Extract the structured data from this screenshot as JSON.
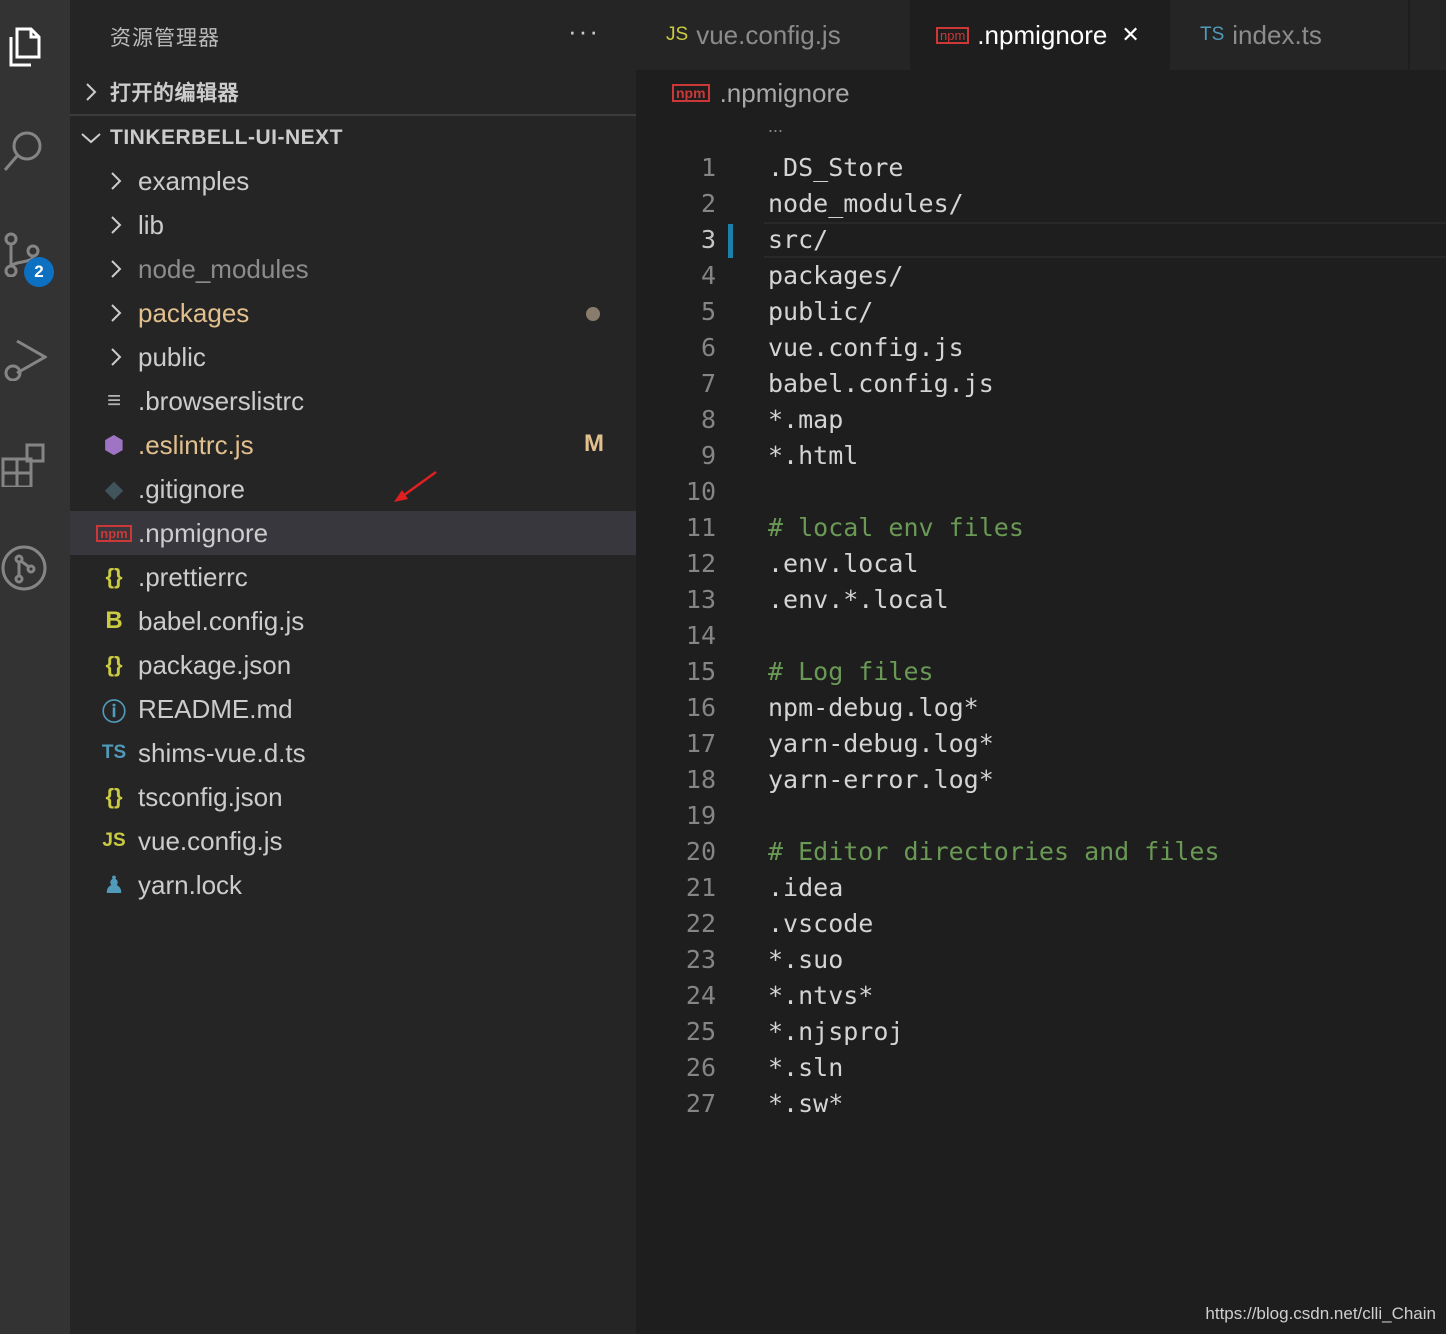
{
  "activity": {
    "badge_count": "2",
    "icons": [
      "files-icon",
      "search-icon",
      "source-control-icon",
      "run-debug-icon",
      "extensions-icon",
      "git-graph-icon"
    ]
  },
  "sidebar": {
    "title": "资源管理器",
    "more": "···",
    "open_editors": "打开的编辑器",
    "project": "TINKERBELL-UI-NEXT",
    "items": [
      {
        "name": "examples",
        "type": "folder",
        "color": "#cccccc"
      },
      {
        "name": "lib",
        "type": "folder",
        "color": "#cccccc"
      },
      {
        "name": "node_modules",
        "type": "folder",
        "color": "#8c8c8c"
      },
      {
        "name": "packages",
        "type": "folder",
        "color": "#e2c08d"
      },
      {
        "name": "public",
        "type": "folder",
        "color": "#cccccc"
      },
      {
        "name": ".browserslistrc",
        "type": "file",
        "icon": "≡",
        "icon_color": "#b5b5b5",
        "color": "#cccccc"
      },
      {
        "name": ".eslintrc.js",
        "type": "file",
        "icon": "⬢",
        "icon_color": "#a074c4",
        "color": "#e2c08d",
        "deco": "M"
      },
      {
        "name": ".gitignore",
        "type": "file",
        "icon": "◆",
        "icon_color": "#41535b",
        "color": "#cccccc"
      },
      {
        "name": ".npmignore",
        "type": "file",
        "icon": "npm",
        "icon_color": "#cb3837",
        "color": "#cccccc"
      },
      {
        "name": ".prettierrc",
        "type": "file",
        "icon": "{}",
        "icon_color": "#cbcb41",
        "color": "#cccccc"
      },
      {
        "name": "babel.config.js",
        "type": "file",
        "icon": "B",
        "icon_color": "#cbcb41",
        "color": "#cccccc"
      },
      {
        "name": "package.json",
        "type": "file",
        "icon": "{}",
        "icon_color": "#cbcb41",
        "color": "#cccccc"
      },
      {
        "name": "README.md",
        "type": "file",
        "icon": "ⓘ",
        "icon_color": "#519aba",
        "color": "#cccccc"
      },
      {
        "name": "shims-vue.d.ts",
        "type": "file",
        "icon": "TS",
        "icon_color": "#519aba",
        "color": "#cccccc"
      },
      {
        "name": "tsconfig.json",
        "type": "file",
        "icon": "{}",
        "icon_color": "#cbcb41",
        "color": "#cccccc"
      },
      {
        "name": "vue.config.js",
        "type": "file",
        "icon": "JS",
        "icon_color": "#cbcb41",
        "color": "#cccccc"
      },
      {
        "name": "yarn.lock",
        "type": "file",
        "icon": "♟",
        "icon_color": "#519aba",
        "color": "#cccccc"
      }
    ]
  },
  "tabs": [
    {
      "icon": "JS",
      "icon_color": "#cbcb41",
      "label": "vue.config.js",
      "active": false
    },
    {
      "icon": "npm",
      "icon_color": "#cb3837",
      "label": ".npmignore",
      "active": true,
      "close": "✕"
    },
    {
      "icon": "TS",
      "icon_color": "#519aba",
      "label": "index.ts",
      "active": false
    }
  ],
  "breadcrumb": {
    "icon": "npm",
    "label": ".npmignore",
    "ellipsis": "..."
  },
  "editor": {
    "current_line": 3,
    "lines": [
      ".DS_Store",
      "node_modules/",
      "src/",
      "packages/",
      "public/",
      "vue.config.js",
      "babel.config.js",
      "*.map",
      "*.html",
      "",
      "# local env files",
      ".env.local",
      ".env.*.local",
      "",
      "# Log files",
      "npm-debug.log*",
      "yarn-debug.log*",
      "yarn-error.log*",
      "",
      "# Editor directories and files",
      ".idea",
      ".vscode",
      "*.suo",
      "*.ntvs*",
      "*.njsproj",
      "*.sln",
      "*.sw*"
    ]
  },
  "watermark": "https://blog.csdn.net/clli_Chain"
}
